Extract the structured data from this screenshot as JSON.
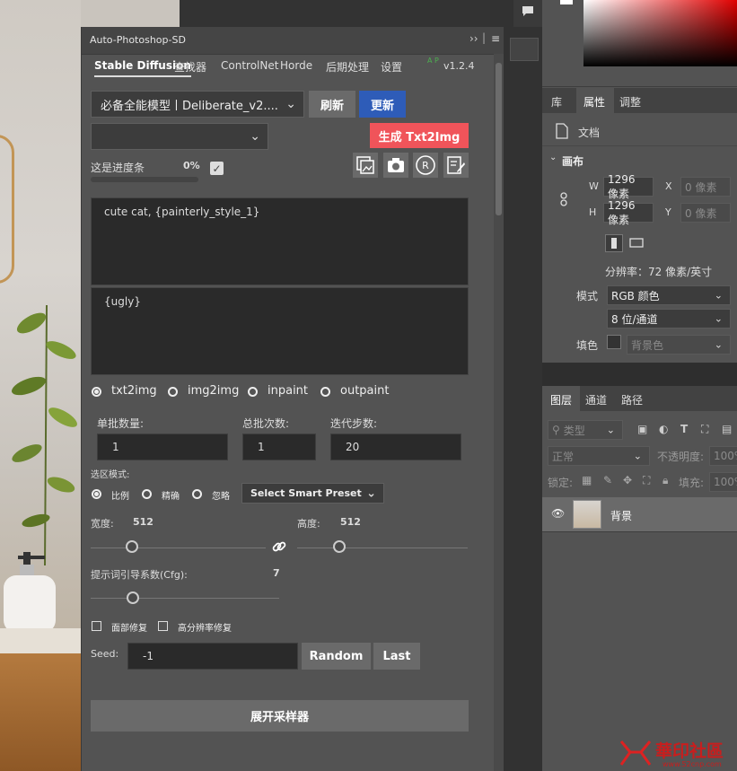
{
  "plugin": {
    "title": "Auto-Photoshop-SD",
    "version": "v1.2.4",
    "version_badge": "A P",
    "tabs": [
      "Stable Diffusion",
      "查找器",
      "ControlNet",
      "Horde",
      "后期处理",
      "设置"
    ],
    "model_value": "必备全能模型丨Deliberate_v2....",
    "refresh_label": "刷新",
    "update_label": "更新",
    "generate_label": "生成 Txt2Img",
    "progress_label": "这是进度条",
    "progress_percent": "0%",
    "progress_value": 0,
    "positive_prompt": "cute cat, {painterly_style_1}",
    "negative_prompt": "{ugly}",
    "modes": [
      {
        "label": "txt2img",
        "selected": true
      },
      {
        "label": "img2img",
        "selected": false
      },
      {
        "label": "inpaint",
        "selected": false
      },
      {
        "label": "outpaint",
        "selected": false
      }
    ],
    "batch_size_label": "单批数量:",
    "batch_size_value": "1",
    "batch_count_label": "总批次数:",
    "batch_count_value": "1",
    "steps_label": "迭代步数:",
    "steps_value": "20",
    "selection_mode_label": "选区模式:",
    "selection_modes": [
      {
        "label": "比例",
        "selected": true
      },
      {
        "label": "精确",
        "selected": false
      },
      {
        "label": "忽略",
        "selected": false
      }
    ],
    "smart_preset_label": "Select Smart Preset",
    "width_label": "宽度:",
    "width_value": "512",
    "height_label": "高度:",
    "height_value": "512",
    "cfg_label": "提示词引导系数(Cfg):",
    "cfg_value": "7",
    "face_fix_label": "面部修复",
    "hires_fix_label": "高分辨率修复",
    "seed_label": "Seed:",
    "seed_value": "-1",
    "random_label": "Random",
    "last_label": "Last",
    "sampler_label": "展开采样器"
  },
  "properties": {
    "tabs": [
      "库",
      "属性",
      "调整"
    ],
    "doc_label": "文档",
    "canvas_label": "画布",
    "w_label": "W",
    "w_value": "1296 像素",
    "h_label": "H",
    "h_value": "1296 像素",
    "x_label": "X",
    "x_value": "0 像素",
    "y_label": "Y",
    "y_value": "0 像素",
    "resolution": "分辨率：72 像素/英寸",
    "mode_label": "模式",
    "mode_value": "RGB 颜色",
    "bit_value": "8 位/通道",
    "fill_label": "填色",
    "fill_value": "背景色"
  },
  "layers": {
    "tabs": [
      "图层",
      "通道",
      "路径"
    ],
    "filter_value": "类型",
    "blend_value": "正常",
    "opacity_label": "不透明度:",
    "opacity_value": "100%",
    "lock_label": "锁定:",
    "fill_label": "填充:",
    "fill_value": "100%",
    "layer_name": "背景"
  },
  "watermark": {
    "text": "華印社區",
    "url": "www.52cnp.com"
  }
}
